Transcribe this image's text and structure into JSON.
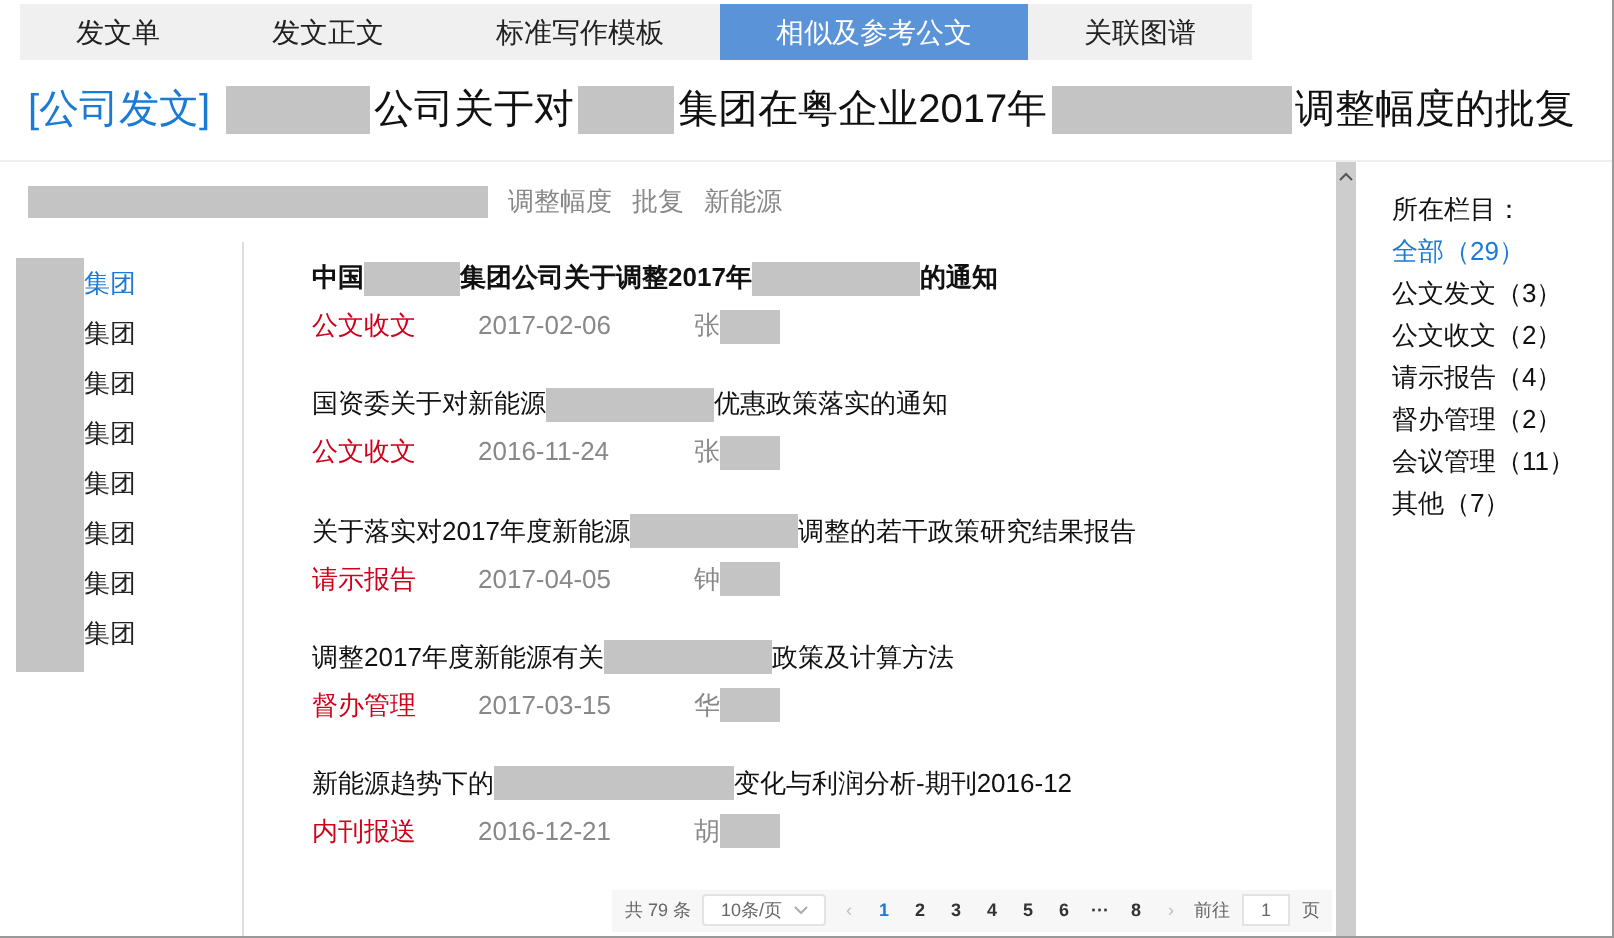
{
  "tabs": [
    {
      "label": "发文单",
      "selected": false
    },
    {
      "label": "发文正文",
      "selected": false
    },
    {
      "label": "标准写作模板",
      "selected": false
    },
    {
      "label": "相似及参考公文",
      "selected": true
    },
    {
      "label": "关联图谱",
      "selected": false
    }
  ],
  "title": {
    "category": "[公司发文]",
    "segments": [
      {
        "kind": "bar"
      },
      {
        "kind": "text",
        "text": "公司关于对"
      },
      {
        "kind": "stub"
      },
      {
        "kind": "text",
        "text": "集团在粤企业2017年"
      },
      {
        "kind": "band"
      },
      {
        "kind": "text",
        "text": "调整幅度的批复"
      }
    ]
  },
  "keywords": [
    {
      "kind": "banner"
    },
    {
      "kind": "text",
      "text": "调整幅度"
    },
    {
      "kind": "text",
      "text": "批复"
    },
    {
      "kind": "text",
      "text": "新能源"
    }
  ],
  "groups": [
    {
      "label": "集团",
      "selected": true
    },
    {
      "label": "集团",
      "selected": false
    },
    {
      "label": "集团",
      "selected": false
    },
    {
      "label": "集团",
      "selected": false
    },
    {
      "label": "集团",
      "selected": false
    },
    {
      "label": "集团",
      "selected": false
    },
    {
      "label": "集团",
      "selected": false
    },
    {
      "label": "集团",
      "selected": false
    }
  ],
  "results": [
    {
      "selected": true,
      "segments": [
        {
          "kind": "text",
          "text": "中国"
        },
        {
          "kind": "stub"
        },
        {
          "kind": "text",
          "text": "集团公司关于调整2017年"
        },
        {
          "kind": "strip"
        },
        {
          "kind": "text",
          "text": "的通知"
        }
      ],
      "category": "公文收文",
      "date": "2017-02-06",
      "author": "张"
    },
    {
      "selected": false,
      "segments": [
        {
          "kind": "text",
          "text": "国资委关于对新能源"
        },
        {
          "kind": "strip"
        },
        {
          "kind": "text",
          "text": "优惠政策落实的通知"
        }
      ],
      "category": "公文收文",
      "date": "2016-11-24",
      "author": "张"
    },
    {
      "selected": false,
      "segments": [
        {
          "kind": "text",
          "text": "关于落实对2017年度新能源"
        },
        {
          "kind": "strip"
        },
        {
          "kind": "text",
          "text": "调整的若干政策研究结果报告"
        }
      ],
      "category": "请示报告",
      "date": "2017-04-05",
      "author": "钟"
    },
    {
      "selected": false,
      "segments": [
        {
          "kind": "text",
          "text": "调整2017年度新能源有关"
        },
        {
          "kind": "strip"
        },
        {
          "kind": "text",
          "text": "政策及计算方法"
        }
      ],
      "category": "督办管理",
      "date": "2017-03-15",
      "author": "华"
    },
    {
      "selected": false,
      "segments": [
        {
          "kind": "text",
          "text": "新能源趋势下的"
        },
        {
          "kind": "band"
        },
        {
          "kind": "text",
          "text": "变化与利润分析-期刊2016-12"
        }
      ],
      "category": "内刊报送",
      "date": "2016-12-21",
      "author": "胡"
    }
  ],
  "pagination": {
    "total": "共 79 条",
    "page_size": "10条/页",
    "prev": "‹",
    "pages": [
      {
        "label": "1",
        "selected": true
      },
      {
        "label": "2",
        "selected": false
      },
      {
        "label": "3",
        "selected": false
      },
      {
        "label": "4",
        "selected": false
      },
      {
        "label": "5",
        "selected": false
      },
      {
        "label": "6",
        "selected": false
      },
      {
        "label": "···",
        "selected": false
      },
      {
        "label": "8",
        "selected": false
      }
    ],
    "next": "›",
    "goto_label": "前往",
    "goto_value": "1",
    "goto_suffix": "页"
  },
  "columns": {
    "heading": "所在栏目：",
    "items": [
      {
        "label": "全部（29）",
        "selected": true
      },
      {
        "label": "公文发文（3）",
        "selected": false
      },
      {
        "label": "公文收文（2）",
        "selected": false
      },
      {
        "label": "请示报告（4）",
        "selected": false
      },
      {
        "label": "督办管理（2）",
        "selected": false
      },
      {
        "label": "会议管理（11）",
        "selected": false
      },
      {
        "label": "其他（7）",
        "selected": false
      }
    ]
  }
}
